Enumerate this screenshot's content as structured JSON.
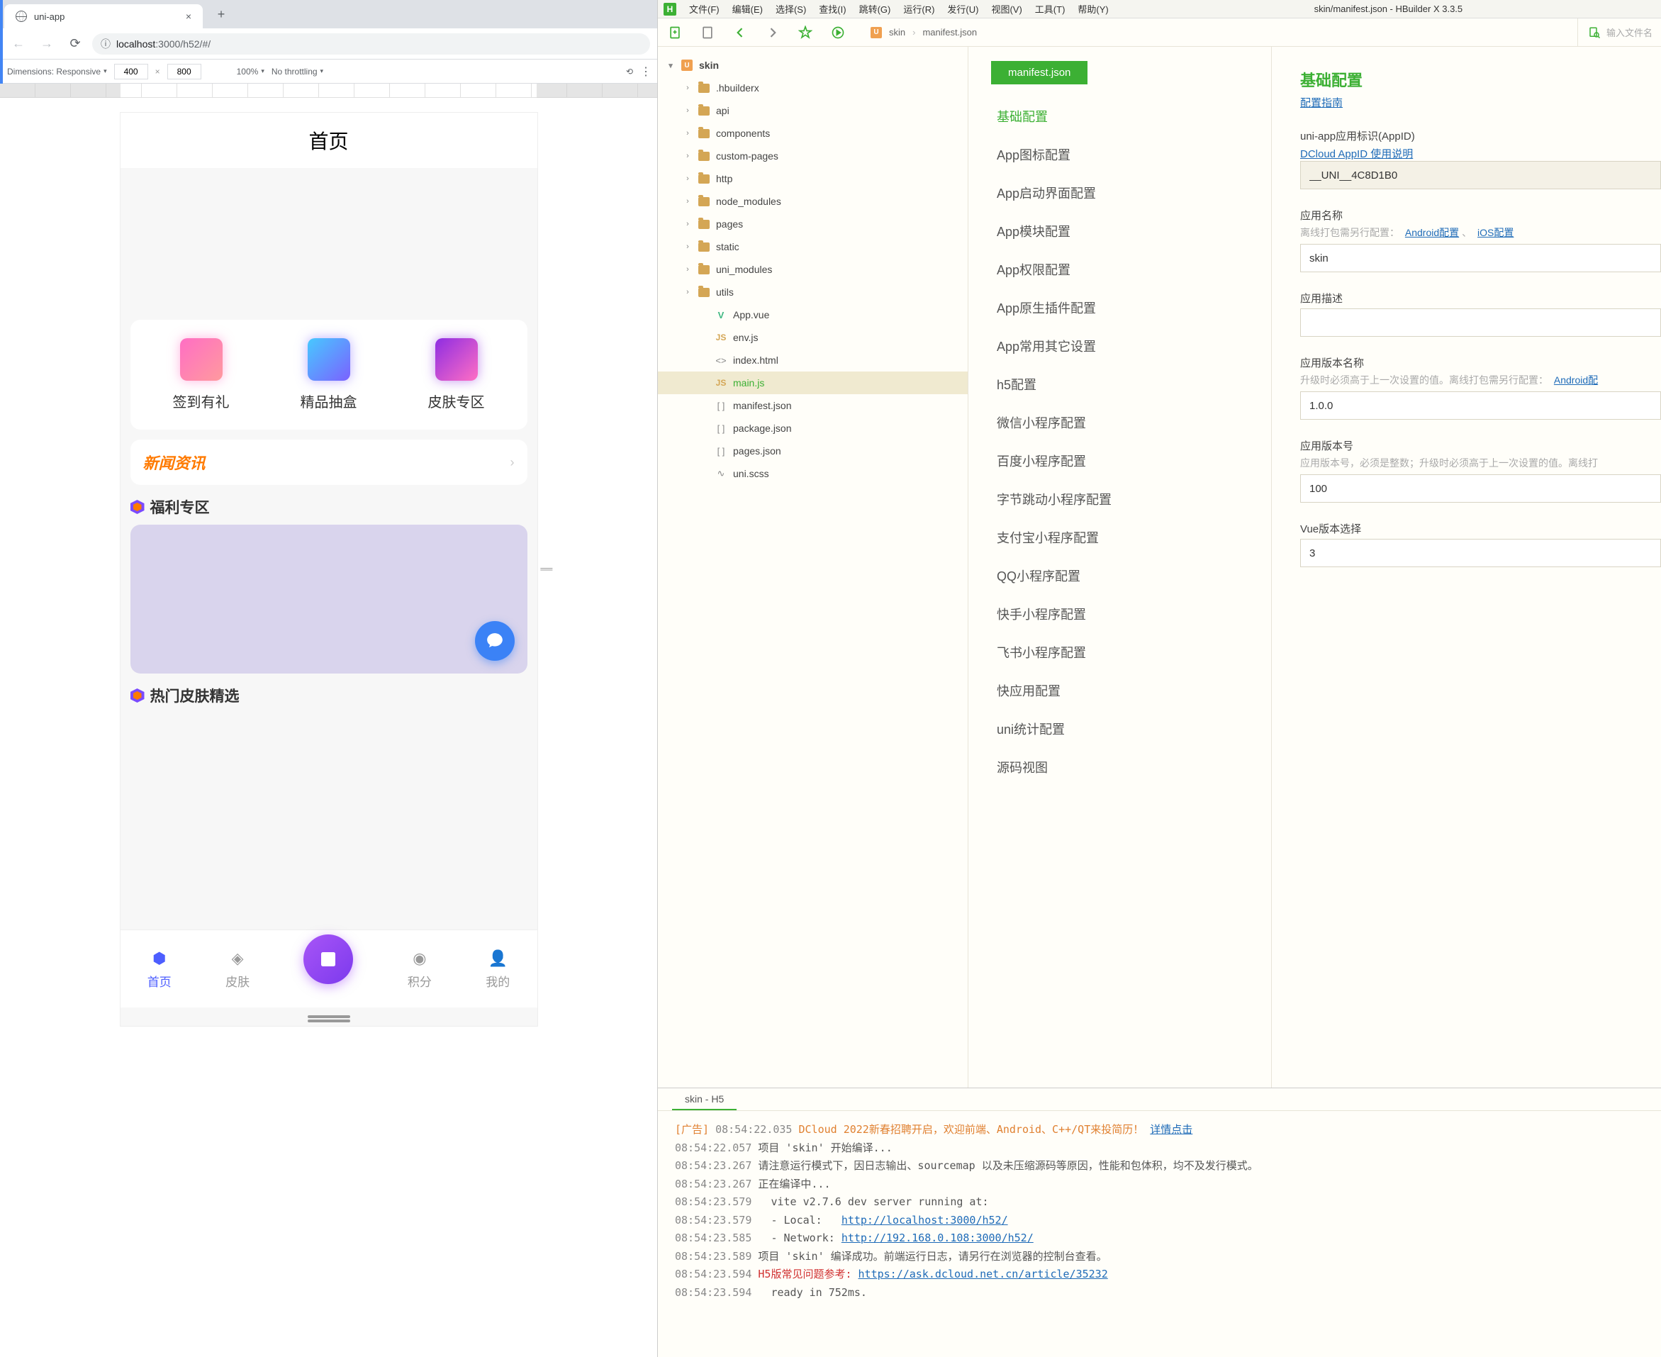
{
  "chrome": {
    "tab_title": "uni-app",
    "url_host": "localhost",
    "url_port": ":3000",
    "url_path": "/h52/#/",
    "devtools": {
      "dimensions_label": "Dimensions: Responsive",
      "width": "400",
      "height": "800",
      "zoom": "100%",
      "throttling": "No throttling"
    }
  },
  "phone": {
    "header": "首页",
    "features": [
      {
        "label": "签到有礼"
      },
      {
        "label": "精品抽盒"
      },
      {
        "label": "皮肤专区"
      }
    ],
    "news_title": "新闻资讯",
    "section_welfare": "福利专区",
    "section_hot": "热门皮肤精选",
    "tabs": [
      {
        "label": "首页"
      },
      {
        "label": "皮肤"
      },
      {
        "label": "积分"
      },
      {
        "label": "我的"
      }
    ]
  },
  "hbuilder": {
    "menus": [
      "文件(F)",
      "编辑(E)",
      "选择(S)",
      "查找(I)",
      "跳转(G)",
      "运行(R)",
      "发行(U)",
      "视图(V)",
      "工具(T)",
      "帮助(Y)"
    ],
    "window_title": "skin/manifest.json - HBuilder X 3.3.5",
    "breadcrumb": [
      "skin",
      "manifest.json"
    ],
    "search_placeholder": "输入文件名",
    "tree": {
      "root": "skin",
      "folders": [
        ".hbuilderx",
        "api",
        "components",
        "custom-pages",
        "http",
        "node_modules",
        "pages",
        "static",
        "uni_modules",
        "utils"
      ],
      "files": [
        {
          "name": "App.vue",
          "type": "vue"
        },
        {
          "name": "env.js",
          "type": "js"
        },
        {
          "name": "index.html",
          "type": "html"
        },
        {
          "name": "main.js",
          "type": "js",
          "selected": true
        },
        {
          "name": "manifest.json",
          "type": "json"
        },
        {
          "name": "package.json",
          "type": "json"
        },
        {
          "name": "pages.json",
          "type": "json"
        },
        {
          "name": "uni.scss",
          "type": "scss"
        }
      ]
    },
    "config_tab": "manifest.json",
    "config_nav": [
      "基础配置",
      "App图标配置",
      "App启动界面配置",
      "App模块配置",
      "App权限配置",
      "App原生插件配置",
      "App常用其它设置",
      "h5配置",
      "微信小程序配置",
      "百度小程序配置",
      "字节跳动小程序配置",
      "支付宝小程序配置",
      "QQ小程序配置",
      "快手小程序配置",
      "飞书小程序配置",
      "快应用配置",
      "uni统计配置",
      "源码视图"
    ],
    "form": {
      "title": "基础配置",
      "guide_link": "配置指南",
      "appid_label": "uni-app应用标识(AppID)",
      "appid_link": "DCloud AppID 使用说明",
      "appid_value": "__UNI__4C8D1B0",
      "name_label": "应用名称",
      "name_hint_prefix": "离线打包需另行配置：",
      "name_link_android": "Android配置",
      "name_link_ios": "iOS配置",
      "name_value": "skin",
      "desc_label": "应用描述",
      "desc_value": "",
      "ver_name_label": "应用版本名称",
      "ver_name_hint": "升级时必须高于上一次设置的值。离线打包需另行配置：",
      "ver_name_link": "Android配",
      "ver_name_value": "1.0.0",
      "ver_code_label": "应用版本号",
      "ver_code_hint": "应用版本号，必须是整数；升级时必须高于上一次设置的值。离线打",
      "ver_code_value": "100",
      "vue_label": "Vue版本选择",
      "vue_value": "3"
    },
    "console": {
      "tab": "skin - H5",
      "lines": [
        {
          "prefix": "[广告]",
          "time": "08:54:22.035",
          "orange": "DCloud 2022新春招聘开启，欢迎前端、Android、C++/QT来投简历！",
          "link": "详情点击"
        },
        {
          "time": "08:54:22.057",
          "text": "项目 'skin' 开始编译..."
        },
        {
          "time": "08:54:23.267",
          "text": "请注意运行模式下，因日志输出、sourcemap 以及未压缩源码等原因，性能和包体积，均不及发行模式。"
        },
        {
          "time": "08:54:23.267",
          "text": "正在编译中..."
        },
        {
          "time": "08:54:23.579",
          "text": "  vite v2.7.6 dev server running at:"
        },
        {
          "time": "08:54:23.579",
          "text": "  - Local:   ",
          "link": "http://localhost:3000/h52/"
        },
        {
          "time": "08:54:23.585",
          "text": "  - Network: ",
          "link": "http://192.168.0.108:3000/h52/"
        },
        {
          "time": "08:54:23.589",
          "text": "项目 'skin' 编译成功。前端运行日志，请另行在浏览器的控制台查看。"
        },
        {
          "time": "08:54:23.594",
          "red": "H5版常见问题参考: ",
          "link": "https://ask.dcloud.net.cn/article/35232"
        },
        {
          "time": "08:54:23.594",
          "text": "  ready in 752ms."
        }
      ]
    }
  }
}
